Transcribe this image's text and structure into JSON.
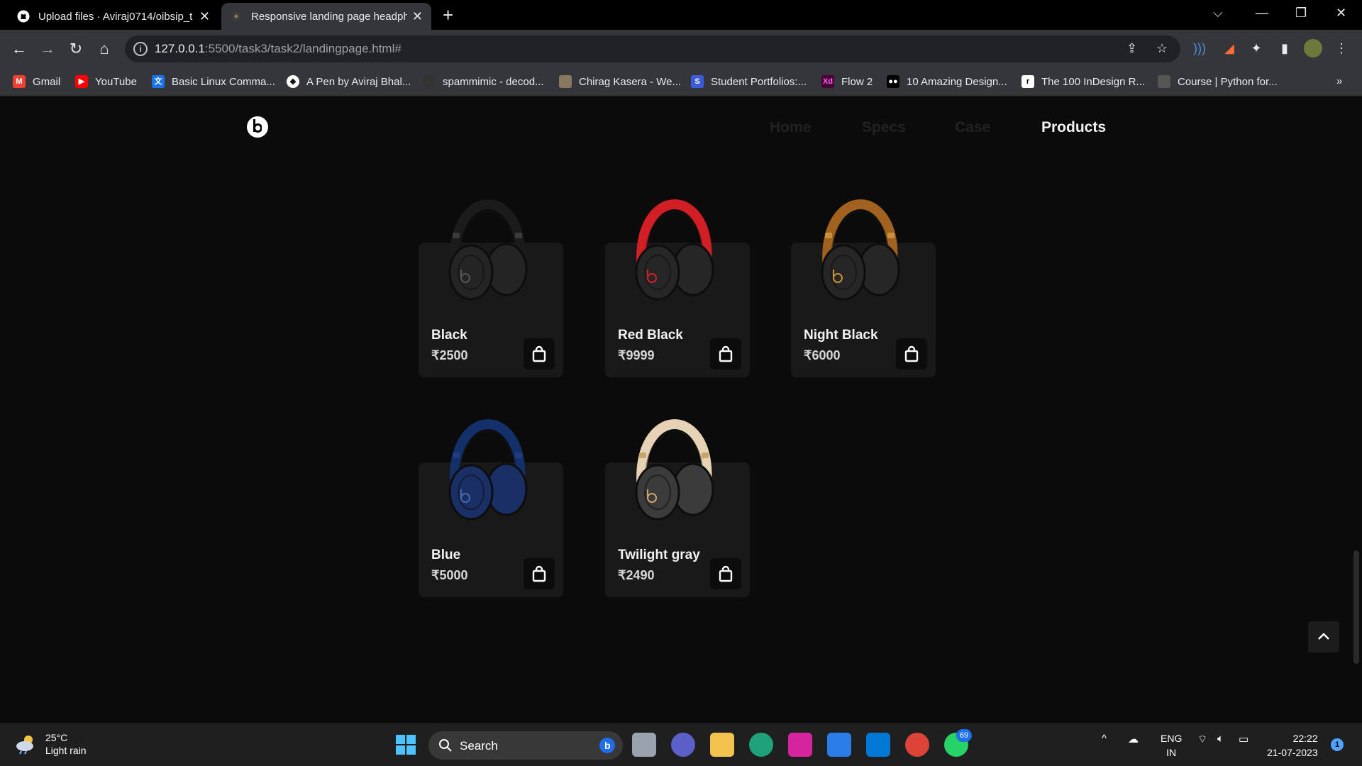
{
  "browser": {
    "tabs": [
      {
        "title": "Upload files · Aviraj0714/oibsip_t",
        "icon": "github-icon"
      },
      {
        "title": "Responsive landing page headph",
        "icon": "page-icon",
        "active": true
      }
    ],
    "url_host": "127.0.0.1",
    "url_rest": ":5500/task3/task2/landingpage.html#",
    "bookmarks": [
      {
        "label": "Gmail",
        "icon": "gmail-icon",
        "color": "#ea4335"
      },
      {
        "label": "YouTube",
        "icon": "youtube-icon",
        "color": "#ff0000"
      },
      {
        "label": "Basic Linux Comma...",
        "icon": "translate-icon",
        "color": "#1a73e8"
      },
      {
        "label": "A Pen by Aviraj Bhal...",
        "icon": "codepen-icon",
        "color": "#000000"
      },
      {
        "label": "spammimic - decod...",
        "icon": "spammimic-icon",
        "color": "#333333"
      },
      {
        "label": "Chirag Kasera - We...",
        "icon": "portrait-icon",
        "color": "#8a7760"
      },
      {
        "label": "Student Portfolios:...",
        "icon": "s-icon",
        "color": "#3b5bdb"
      },
      {
        "label": "Flow 2",
        "icon": "xd-icon",
        "color": "#470137"
      },
      {
        "label": "10 Amazing Design...",
        "icon": "medium-icon",
        "color": "#000000"
      },
      {
        "label": "The 100 InDesign R...",
        "icon": "r-icon",
        "color": "#ffffff"
      },
      {
        "label": "Course | Python for...",
        "icon": "course-icon",
        "color": "#555555"
      }
    ]
  },
  "site": {
    "nav": [
      {
        "label": "Home",
        "active": false
      },
      {
        "label": "Specs",
        "active": false
      },
      {
        "label": "Case",
        "active": false
      },
      {
        "label": "Products",
        "active": true
      }
    ],
    "products": [
      {
        "name": "Black",
        "price": "₹2500",
        "colors": {
          "band": "#1b1b1b",
          "cup": "#242424",
          "accent": "#3a3a3a",
          "logo": "#555555"
        }
      },
      {
        "name": "Red Black",
        "price": "₹9999",
        "colors": {
          "band": "#d21f26",
          "cup": "#262626",
          "accent": "#d21f26",
          "logo": "#d21f26"
        }
      },
      {
        "name": "Night Black",
        "price": "₹6000",
        "colors": {
          "band": "#a0621e",
          "cup": "#262626",
          "accent": "#c8913a",
          "logo": "#c8913a"
        }
      },
      {
        "name": "Blue",
        "price": "₹5000",
        "colors": {
          "band": "#14306b",
          "cup": "#1a2f66",
          "accent": "#1f3c80",
          "logo": "#4a68a8"
        }
      },
      {
        "name": "Twilight gray",
        "price": "₹2490",
        "colors": {
          "band": "#e6d2b5",
          "cup": "#3b3b3b",
          "accent": "#c9a46a",
          "logo": "#c9a46a"
        }
      }
    ]
  },
  "taskbar": {
    "temperature": "25°C",
    "condition": "Light rain",
    "search_label": "Search",
    "whatsapp_badge": "69",
    "lang_top": "ENG",
    "lang_bottom": "IN",
    "time": "22:22",
    "date": "21-07-2023",
    "notification_count": "1"
  }
}
